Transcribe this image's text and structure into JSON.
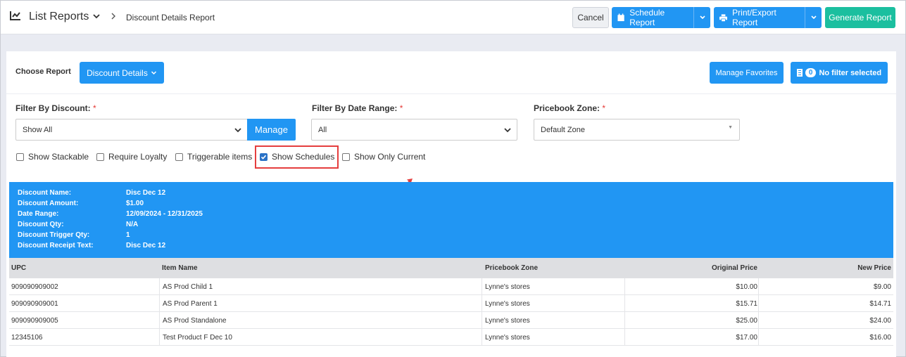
{
  "header": {
    "title": "List Reports",
    "breadcrumb": "Discount Details Report",
    "buttons": {
      "cancel": "Cancel",
      "schedule": "Schedule Report",
      "print_export": "Print/Export Report",
      "generate": "Generate Report"
    }
  },
  "report_bar": {
    "choose_label": "Choose Report",
    "report_select": "Discount Details",
    "manage_favorites": "Manage Favorites",
    "filter_count": "0",
    "filter_status": "No filter selected"
  },
  "filters": {
    "discount": {
      "label": "Filter By Discount:",
      "required": "*",
      "value": "Show All",
      "manage": "Manage"
    },
    "date_range": {
      "label": "Filter By Date Range:",
      "required": "*",
      "value": "All"
    },
    "pricebook_zone": {
      "label": "Pricebook Zone:",
      "required": "*",
      "value": "Default Zone"
    }
  },
  "checkboxes": [
    {
      "label": "Show Stackable",
      "checked": false
    },
    {
      "label": "Require Loyalty",
      "checked": false
    },
    {
      "label": "Triggerable items",
      "checked": false
    },
    {
      "label": "Show Schedules",
      "checked": true
    },
    {
      "label": "Show Only Current",
      "checked": false
    }
  ],
  "discount_info": [
    {
      "label": "Discount Name:",
      "value": "Disc Dec 12"
    },
    {
      "label": "Discount Amount:",
      "value": "$1.00"
    },
    {
      "label": "Date Range:",
      "value": "12/09/2024 - 12/31/2025"
    },
    {
      "label": "Discount Qty:",
      "value": "N/A"
    },
    {
      "label": "Discount Trigger Qty:",
      "value": "1"
    },
    {
      "label": "Discount Receipt Text:",
      "value": "Disc Dec 12"
    }
  ],
  "table": {
    "columns": [
      "UPC",
      "Item Name",
      "Pricebook Zone",
      "Original Price",
      "New Price"
    ],
    "rows": [
      [
        "909090909002",
        "AS Prod Child 1",
        "Lynne's stores",
        "$10.00",
        "$9.00"
      ],
      [
        "909090909001",
        "AS Prod Parent 1",
        "Lynne's stores",
        "$15.71",
        "$14.71"
      ],
      [
        "909090909005",
        "AS Prod Standalone",
        "Lynne's stores",
        "$25.00",
        "$24.00"
      ],
      [
        "12345106",
        "Test Product F Dec 10",
        "Lynne's stores",
        "$17.00",
        "$16.00"
      ]
    ]
  },
  "colors": {
    "primary": "#2196f3",
    "generate": "#1bbf9f",
    "highlight": "#e53e3e"
  }
}
